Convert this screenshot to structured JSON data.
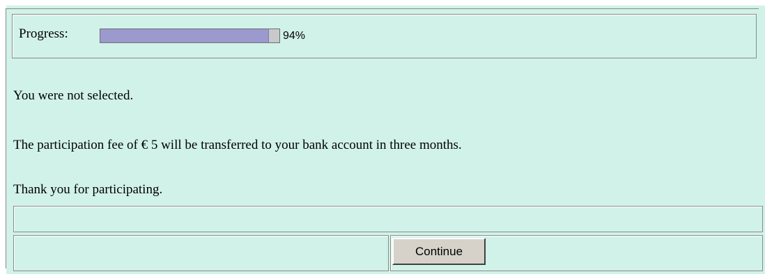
{
  "progress": {
    "label": "Progress:",
    "value_fraction": 0.94,
    "percent_text": "94%",
    "fill_color": "#9b99cd",
    "track_color": "#c9c9c9"
  },
  "messages": {
    "not_selected": "You were not selected.",
    "fee": "The participation fee of € 5 will be transferred to your bank account in three months.",
    "thanks": "Thank you for participating."
  },
  "actions": {
    "continue_label": "Continue"
  },
  "colors": {
    "background": "#d1f2e8",
    "button_face": "#d6d2ca"
  }
}
